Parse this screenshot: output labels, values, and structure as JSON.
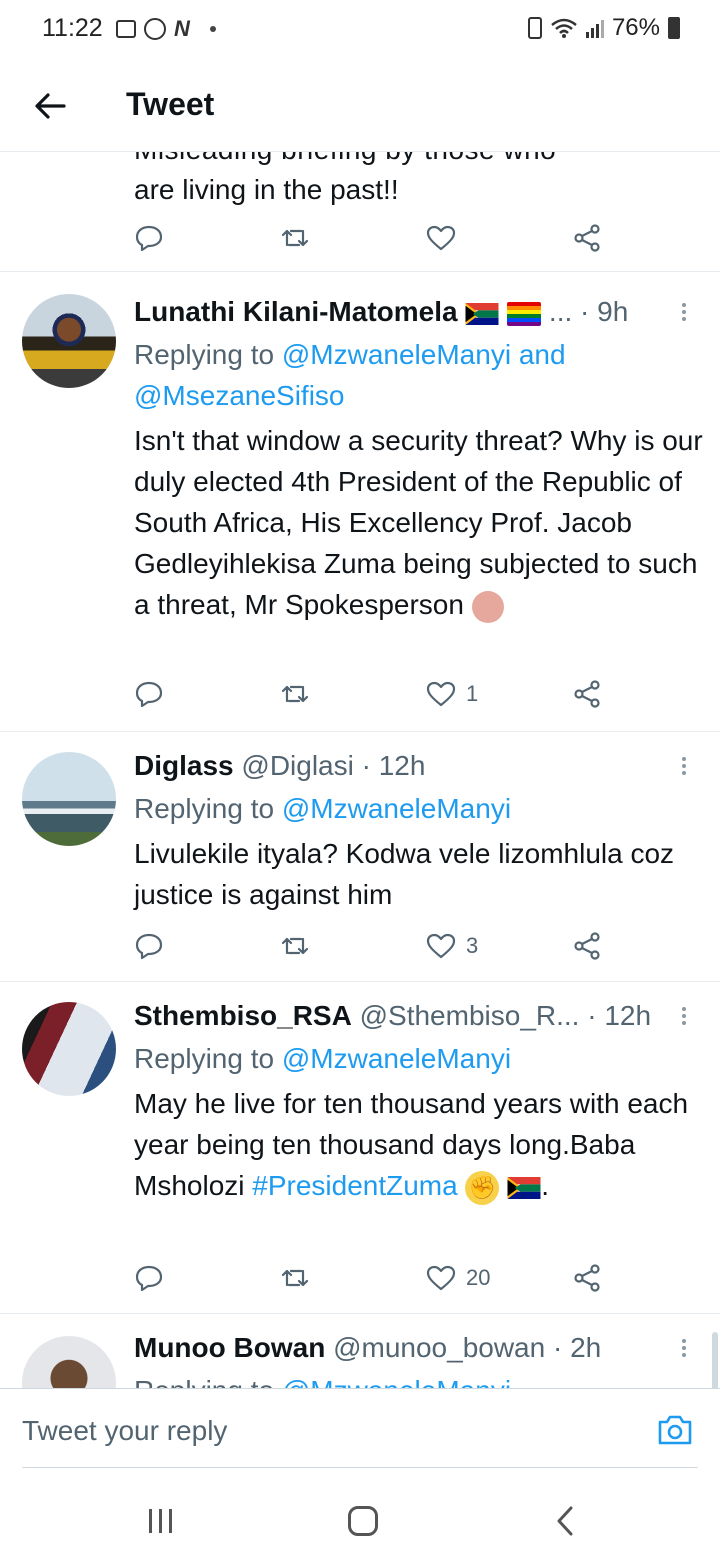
{
  "status_bar": {
    "time": "11:22",
    "battery": "76%"
  },
  "header": {
    "title": "Tweet"
  },
  "partial_tweet": {
    "cut_text": "Misleading briefing by those who",
    "text": "are living in the past!!"
  },
  "tweets": [
    {
      "name": "Lunathi Kilani-Matomela",
      "handle": "...",
      "time": "· 9h",
      "replying_prefix": "Replying to ",
      "mention1": "@MzwaneleManyi",
      "joiner": " and",
      "mention2": "@MsezaneSifiso",
      "body": "Isn't that window a security threat? Why is our duly elected 4th President of the Republic of South Africa, His Excellency Prof. Jacob Gedleyihlekisa Zuma being subjected to such a threat, Mr Spokesperson",
      "likes": "1"
    },
    {
      "name": "Diglass",
      "handle": "@Diglasi",
      "time": "· 12h",
      "replying_prefix": "Replying to ",
      "mention1": "@MzwaneleManyi",
      "body": "Livulekile ityala? Kodwa vele lizomhlula coz justice is against him",
      "likes": "3"
    },
    {
      "name": "Sthembiso_RSA",
      "handle": "@Sthembiso_R...",
      "time": "· 12h",
      "replying_prefix": "Replying to ",
      "mention1": "@MzwaneleManyi",
      "body": "May he live for ten thousand years with each year being ten thousand days long.Baba Msholozi ",
      "hashtag": "#PresidentZuma",
      "likes": "20"
    },
    {
      "name": "Munoo Bowan",
      "handle": "@munoo_bowan",
      "time": "· 2h",
      "replying_prefix": "Replying to ",
      "mention1": "@MzwaneleManyi"
    }
  ],
  "reply_bar": {
    "placeholder": "Tweet your reply"
  },
  "icons": {
    "reply": "reply-icon",
    "retweet": "retweet-icon",
    "like": "heart-icon",
    "share": "share-icon",
    "camera": "camera-icon",
    "back": "back-arrow-icon"
  },
  "colors": {
    "accent": "#1d9bf0",
    "muted": "#536471",
    "text": "#0f1419"
  }
}
